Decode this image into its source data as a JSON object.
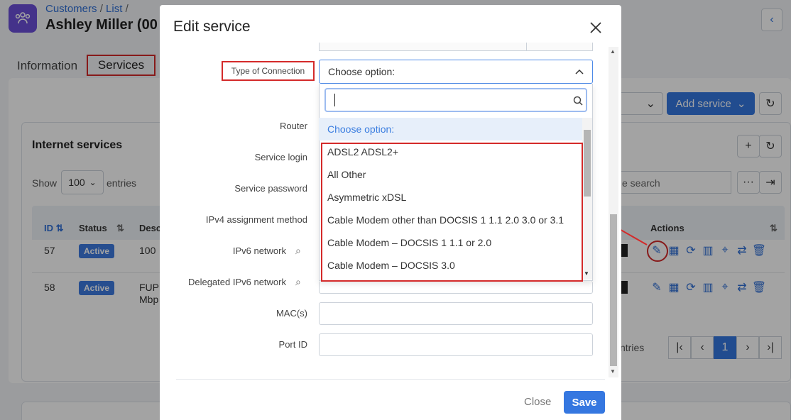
{
  "header": {
    "breadcrumb": [
      "Customers",
      "List"
    ],
    "title": "Ashley Miller (00"
  },
  "tabs": [
    {
      "label": "Information"
    },
    {
      "label": "Services"
    }
  ],
  "panel": {
    "title": "Internet services",
    "show_label": "Show",
    "entries_value": "100",
    "entries_label": "entries",
    "add_service": "Add service",
    "search_placeholder": "e search",
    "columns": [
      "ID",
      "Status",
      "Desc",
      "Actions"
    ],
    "rows": [
      {
        "id": "57",
        "status": "Active",
        "desc": "100"
      },
      {
        "id": "58",
        "status": "Active",
        "desc": "FUP",
        "desc2": "Mbp"
      }
    ],
    "showing_suffix": "ntries",
    "page": "1"
  },
  "modal": {
    "title": "Edit service",
    "fields": {
      "type_of_connection": "Type of Connection",
      "router": "Router",
      "service_login": "Service login",
      "service_password": "Service password",
      "ipv4_method": "IPv4 assignment method",
      "ipv6_network": "IPv6 network",
      "delegated_ipv6": "Delegated IPv6 network",
      "mac": "MAC(s)",
      "port_id": "Port ID"
    },
    "select_value": "Choose option:",
    "options": [
      "Choose option:",
      "ADSL2 ADSL2+",
      "All Other",
      "Asymmetric xDSL",
      "Cable Modem other than DOCSIS 1 1.1 2.0 3.0 or 3.1",
      "Cable Modem – DOCSIS 1 1.1 or 2.0",
      "Cable Modem – DOCSIS 3.0"
    ],
    "close_label": "Close",
    "save_label": "Save"
  },
  "colors": {
    "accent": "#3577e0",
    "highlight": "#d42a2a",
    "app_icon": "#6b4fd8"
  }
}
